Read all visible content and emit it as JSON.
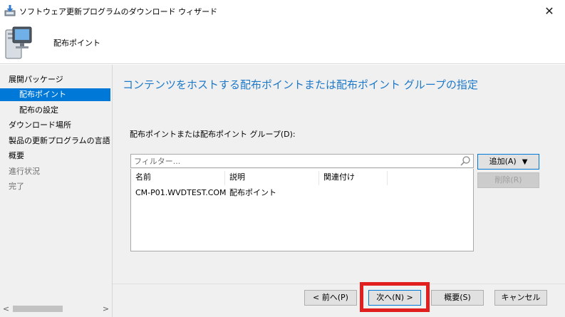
{
  "window": {
    "title": "ソフトウェア更新プログラムのダウンロード ウィザード",
    "close_glyph": "✕"
  },
  "header": {
    "heading": "配布ポイント"
  },
  "nav": {
    "items": [
      {
        "label": "展開パッケージ",
        "state": "normal"
      },
      {
        "label": "配布ポイント",
        "state": "active"
      },
      {
        "label": "配布の設定",
        "state": "normal"
      },
      {
        "label": "ダウンロード場所",
        "state": "normal"
      },
      {
        "label": "製品の更新プログラムの言語の",
        "state": "normal"
      },
      {
        "label": "概要",
        "state": "normal"
      },
      {
        "label": "進行状況",
        "state": "disabled"
      },
      {
        "label": "完了",
        "state": "disabled"
      }
    ],
    "scroll_left": "<",
    "scroll_right": ">"
  },
  "main": {
    "page_title": "コンテンツをホストする配布ポイントまたは配布ポイント グループの指定",
    "dp_label": "配布ポイントまたは配布ポイント グループ(D):",
    "filter_placeholder": "フィルター...",
    "columns": [
      "名前",
      "説明",
      "関連付け"
    ],
    "rows": [
      [
        "CM-P01.WVDTEST.COM",
        "配布ポイント",
        ""
      ]
    ],
    "add_label": "追加(A)",
    "add_caret": "▼",
    "remove_label": "削除(R)"
  },
  "footer": {
    "back_label": "< 前へ(P)",
    "next_label": "次へ(N) >",
    "summary_label": "概要(S)",
    "cancel_label": "キャンセル"
  },
  "colors": {
    "accent": "#0078d7",
    "title_blue": "#1e78c8",
    "highlight_red": "#e11f1f"
  },
  "icons": {
    "app": "download-icon",
    "header": "computer-icon",
    "filter": "search-icon"
  }
}
